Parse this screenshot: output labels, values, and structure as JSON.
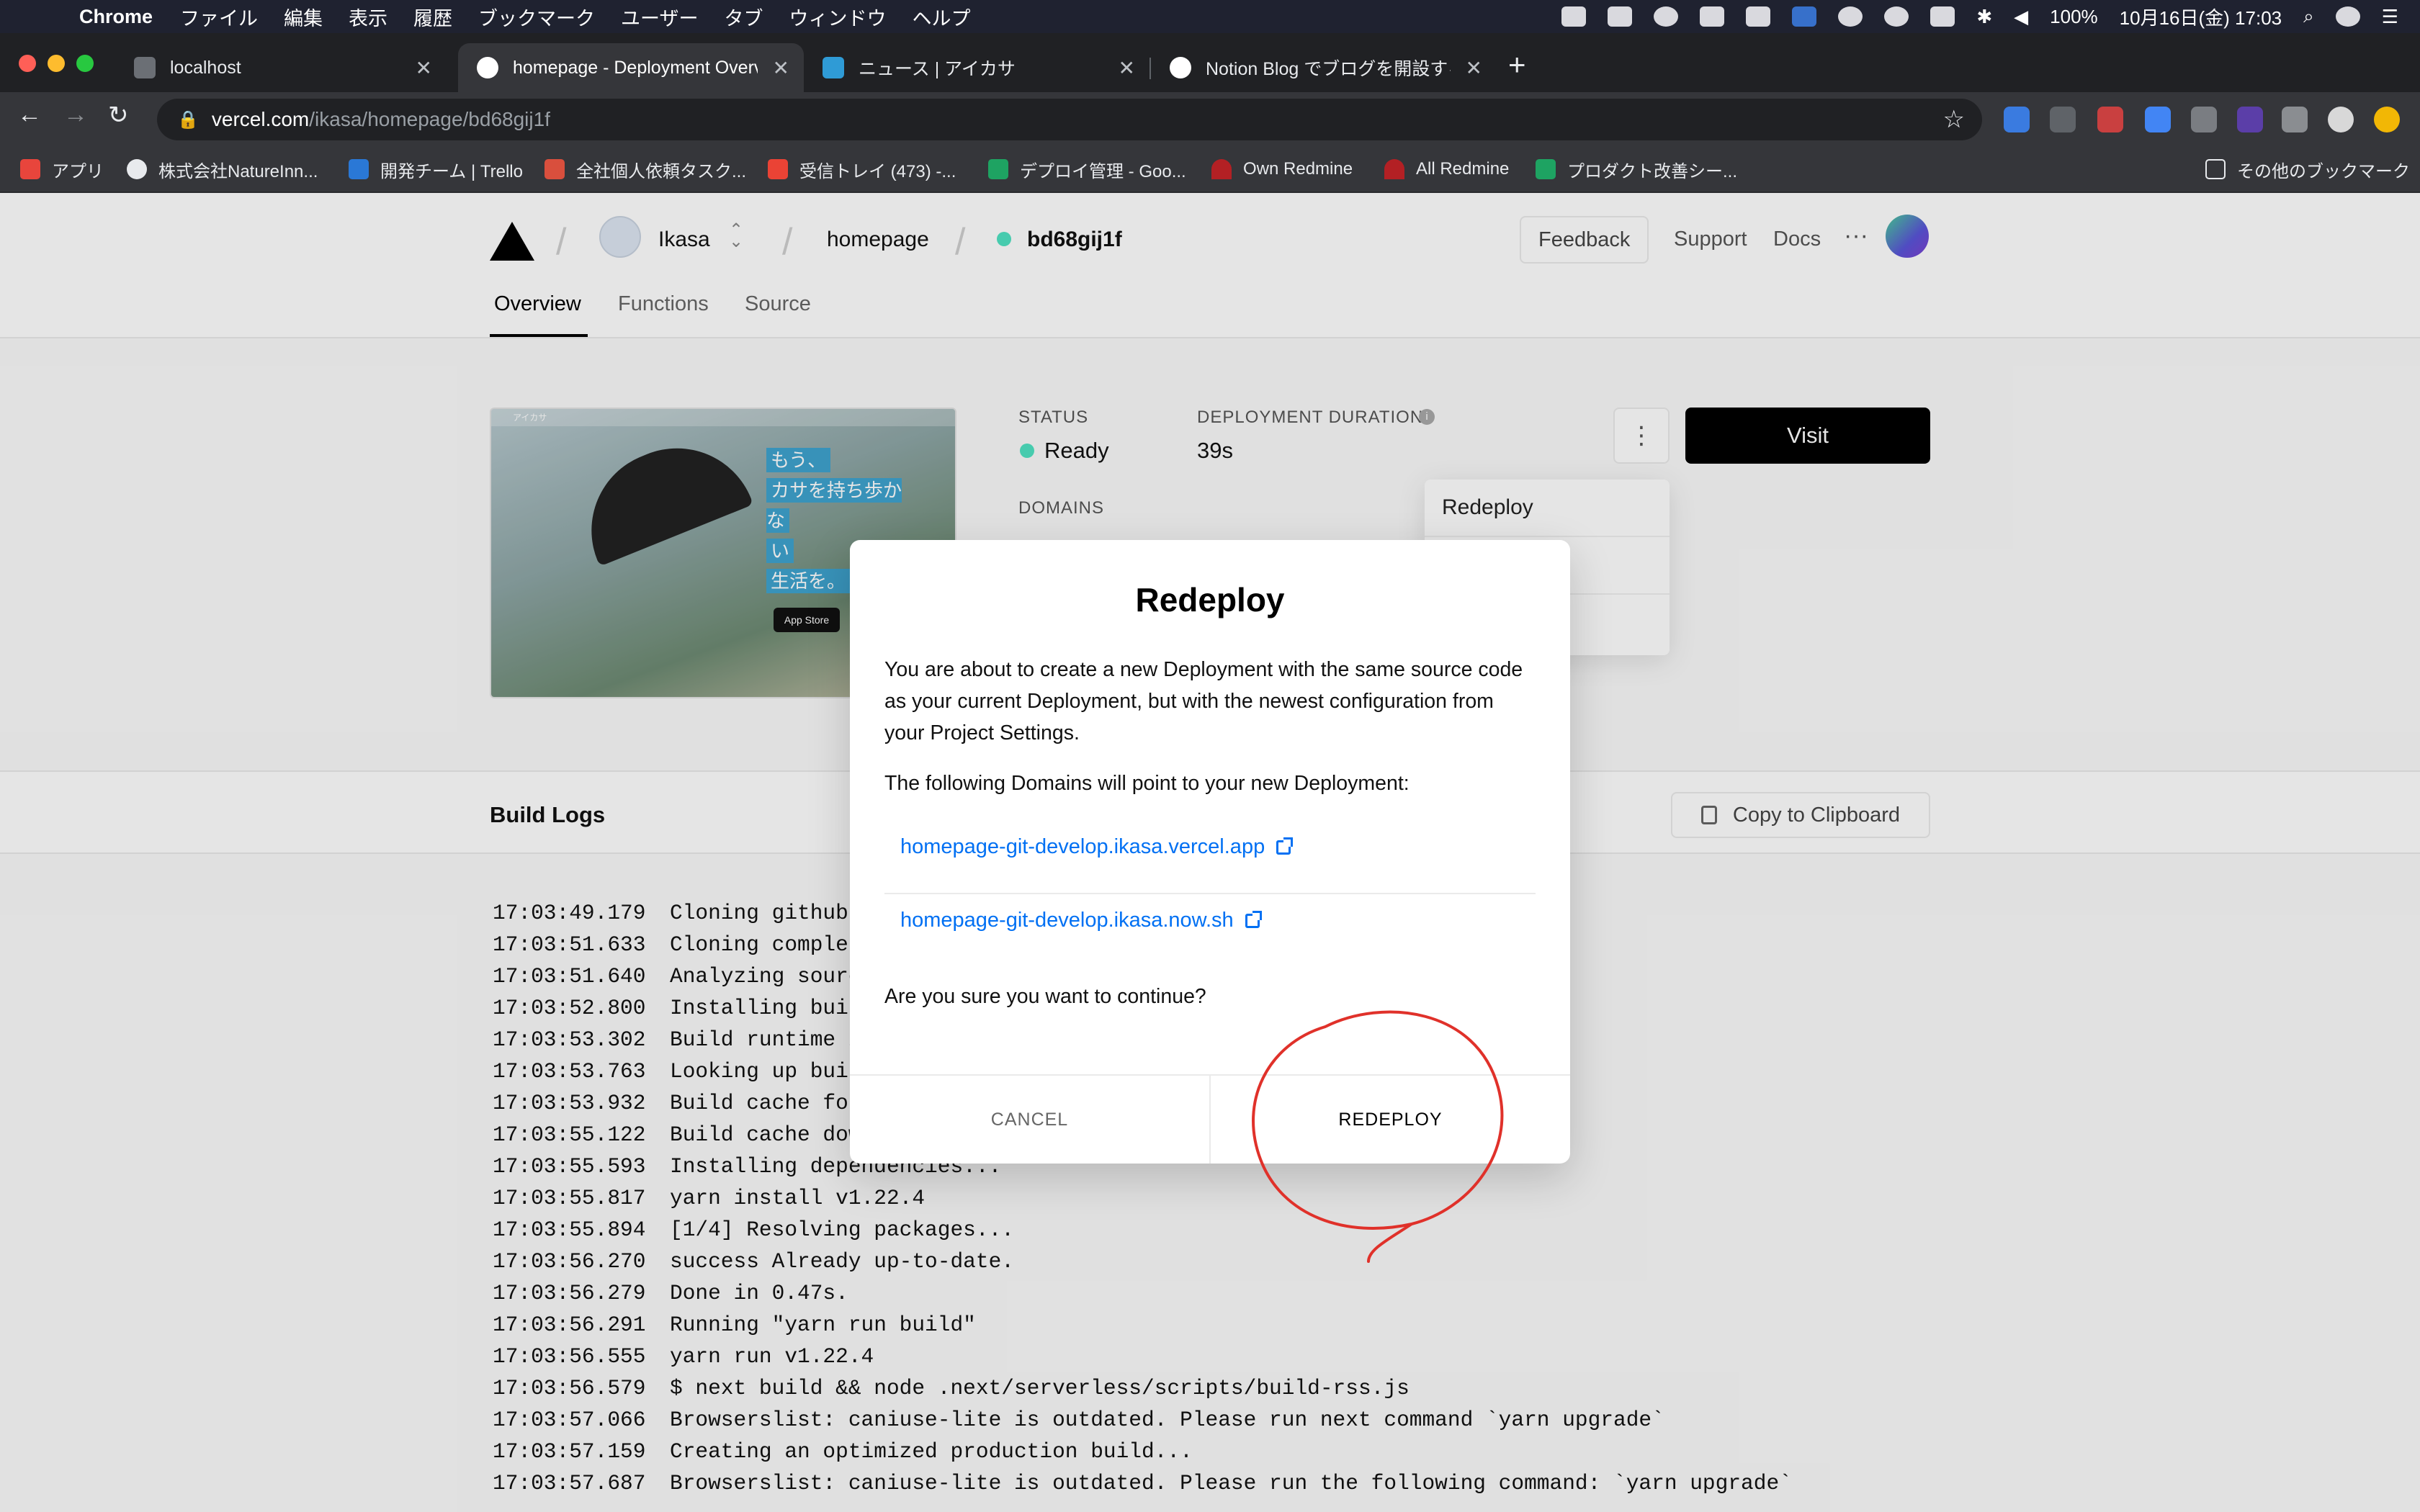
{
  "menubar": {
    "app": "Chrome",
    "items": [
      "ファイル",
      "編集",
      "表示",
      "履歴",
      "ブックマーク",
      "ユーザー",
      "タブ",
      "ウィンドウ",
      "ヘルプ"
    ],
    "battery": "100%",
    "datetime": "10月16日(金) 17:03"
  },
  "tabs": [
    {
      "label": "localhost"
    },
    {
      "label": "homepage - Deployment Overview"
    },
    {
      "label": "ニュース | アイカサ"
    },
    {
      "label": "Notion Blog でブログを開設する"
    }
  ],
  "omnibox": {
    "host": "vercel.com",
    "path": "/ikasa/homepage/bd68gij1f"
  },
  "bookmarks": [
    "アプリ",
    "株式会社NatureInn...",
    "開発チーム | Trello",
    "全社個人依頼タスク...",
    "受信トレイ (473) -...",
    "デプロイ管理 - Goo...",
    "Own Redmine",
    "All Redmine",
    "プロダクト改善シー...",
    "その他のブックマーク"
  ],
  "header": {
    "team": "Ikasa",
    "project": "homepage",
    "deployment": "bd68gij1f",
    "feedback": "Feedback",
    "support": "Support",
    "docs": "Docs",
    "more": "···"
  },
  "project_tabs": [
    "Overview",
    "Functions",
    "Source"
  ],
  "preview": {
    "topline": "アイカサ",
    "headline": [
      "もう、",
      "カサを持ち歩かな",
      "い",
      "生活を。"
    ],
    "store": "App Store"
  },
  "deployment": {
    "status_label": "STATUS",
    "status": "Ready",
    "duration_label": "DEPLOYMENT DURATION",
    "duration": "39s",
    "domains_label": "DOMAINS",
    "visit": "Visit",
    "kebab": "⋮"
  },
  "dropdown": {
    "items": [
      "Redeploy",
      "",
      ""
    ]
  },
  "build": {
    "title": "Build Logs",
    "copy": "Copy to Clipboard",
    "logs": [
      {
        "t": "17:03:49.179",
        "m": "Cloning github."
      },
      {
        "t": "17:03:51.633",
        "m": "Cloning complet"
      },
      {
        "t": "17:03:51.640",
        "m": "Analyzing sourc"
      },
      {
        "t": "17:03:52.800",
        "m": "Installing buil"
      },
      {
        "t": "17:03:53.302",
        "m": "Build runtime i"
      },
      {
        "t": "17:03:53.763",
        "m": "Looking up buil"
      },
      {
        "t": "17:03:53.932",
        "m": "Build cache fou"
      },
      {
        "t": "17:03:55.122",
        "m": "Build cache dow"
      },
      {
        "t": "17:03:55.593",
        "m": "Installing dependencies..."
      },
      {
        "t": "17:03:55.817",
        "m": "yarn install v1.22.4"
      },
      {
        "t": "17:03:55.894",
        "m": "[1/4] Resolving packages..."
      },
      {
        "t": "17:03:56.270",
        "m": "success Already up-to-date."
      },
      {
        "t": "17:03:56.279",
        "m": "Done in 0.47s."
      },
      {
        "t": "17:03:56.291",
        "m": "Running \"yarn run build\""
      },
      {
        "t": "17:03:56.555",
        "m": "yarn run v1.22.4"
      },
      {
        "t": "17:03:56.579",
        "m": "$ next build && node .next/serverless/scripts/build-rss.js"
      },
      {
        "t": "17:03:57.066",
        "m": "Browserslist: caniuse-lite is outdated. Please run next command `yarn upgrade`"
      },
      {
        "t": "17:03:57.159",
        "m": "Creating an optimized production build..."
      },
      {
        "t": "17:03:57.687",
        "m": "Browserslist: caniuse-lite is outdated. Please run the following command: `yarn upgrade`"
      }
    ]
  },
  "modal": {
    "title": "Redeploy",
    "body1": "You are about to create a new Deployment with the same source code as your current Deployment, but with the newest configuration from your Project Settings.",
    "body2": "The following Domains will point to your new Deployment:",
    "domains": [
      "homepage-git-develop.ikasa.vercel.app",
      "homepage-git-develop.ikasa.now.sh"
    ],
    "confirm": "Are you sure you want to continue?",
    "cancel": "CANCEL",
    "redeploy": "REDEPLOY"
  },
  "colors": {
    "accent": "#0070f3",
    "ready": "#50e3c2",
    "annotation": "#e0312a"
  }
}
